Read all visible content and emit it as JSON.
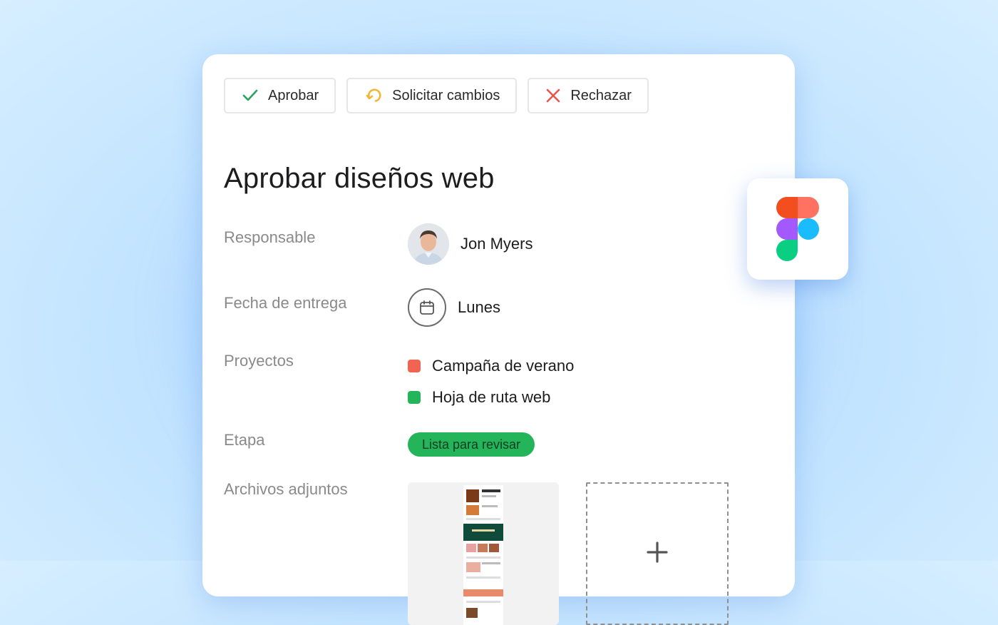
{
  "actions": {
    "approve": "Aprobar",
    "request_changes": "Solicitar cambios",
    "reject": "Rechazar"
  },
  "task": {
    "title": "Aprobar diseños web",
    "fields": {
      "assignee_label": "Responsable",
      "assignee_name": "Jon Myers",
      "due_label": "Fecha de entrega",
      "due_value": "Lunes",
      "projects_label": "Proyectos",
      "projects": [
        {
          "name": "Campaña de verano",
          "color": "#f26452"
        },
        {
          "name": "Hoja de ruta web",
          "color": "#24b45a"
        }
      ],
      "stage_label": "Etapa",
      "stage_value": "Lista para revisar",
      "attachments_label": "Archivos adjuntos"
    }
  },
  "icons": {
    "approve": "check-icon",
    "request_changes": "refresh-icon",
    "reject": "close-icon",
    "due": "calendar-icon",
    "add_attachment": "plus-icon",
    "integration": "figma-logo"
  },
  "colors": {
    "approve_green": "#2aa35a",
    "request_yellow": "#f2b632",
    "reject_red": "#e8584b",
    "stage_green": "#24b45a"
  }
}
